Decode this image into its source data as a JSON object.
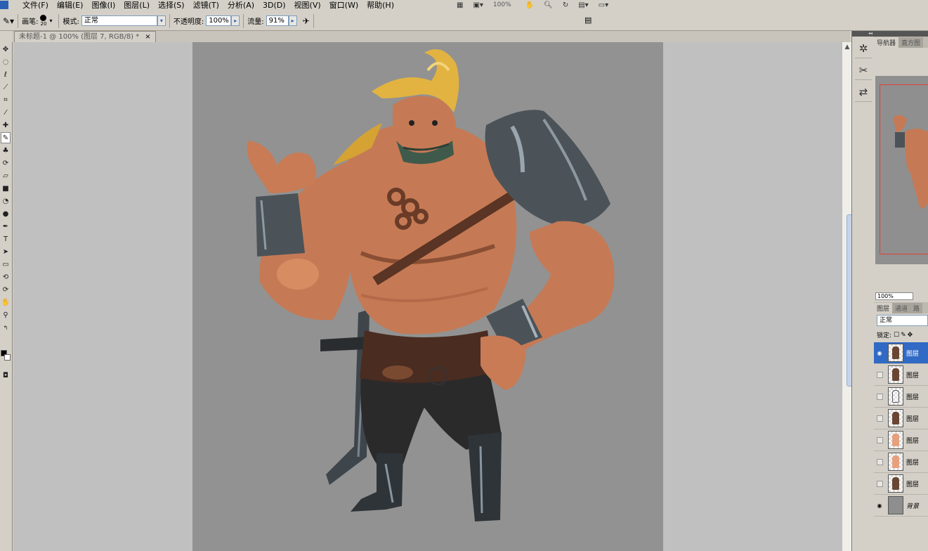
{
  "menubar": {
    "items": [
      "文件(F)",
      "编辑(E)",
      "图像(I)",
      "图层(L)",
      "选择(S)",
      "滤镜(T)",
      "分析(A)",
      "3D(D)",
      "视图(V)",
      "窗口(W)",
      "帮助(H)"
    ],
    "zoom": "100%"
  },
  "options": {
    "brush_label": "画笔:",
    "brush_size": "20",
    "mode_label": "模式:",
    "mode_value": "正常",
    "opacity_label": "不透明度:",
    "opacity_value": "100%",
    "flow_label": "流量:",
    "flow_value": "91%"
  },
  "document": {
    "tab_title": "未标题-1 @ 100% (图层 7, RGB/8) *",
    "close": "×"
  },
  "navigator": {
    "tabs": [
      "导航器",
      "直方图"
    ],
    "zoom": "100%"
  },
  "layers_panel": {
    "tabs": [
      "图层",
      "通道",
      "路"
    ],
    "blend_mode": "正常",
    "lock_label": "锁定:",
    "layers": [
      {
        "name": "图层",
        "visible": true,
        "selected": true,
        "thumb": "figure"
      },
      {
        "name": "图层",
        "visible": false,
        "selected": false,
        "thumb": "figure"
      },
      {
        "name": "图层",
        "visible": false,
        "selected": false,
        "thumb": "sketch"
      },
      {
        "name": "图层",
        "visible": false,
        "selected": false,
        "thumb": "figure"
      },
      {
        "name": "图层",
        "visible": false,
        "selected": false,
        "thumb": "skin"
      },
      {
        "name": "图层",
        "visible": false,
        "selected": false,
        "thumb": "skin"
      },
      {
        "name": "图层",
        "visible": false,
        "selected": false,
        "thumb": "figure"
      },
      {
        "name": "背景",
        "visible": true,
        "selected": false,
        "thumb": "gray"
      }
    ]
  },
  "colors": {
    "canvas_bg": "#929292",
    "workspace": "#c0c0c0",
    "selection": "#316ac5",
    "skin": "#c77a52",
    "armor": "#4a5158",
    "hair": "#e3b33e"
  }
}
